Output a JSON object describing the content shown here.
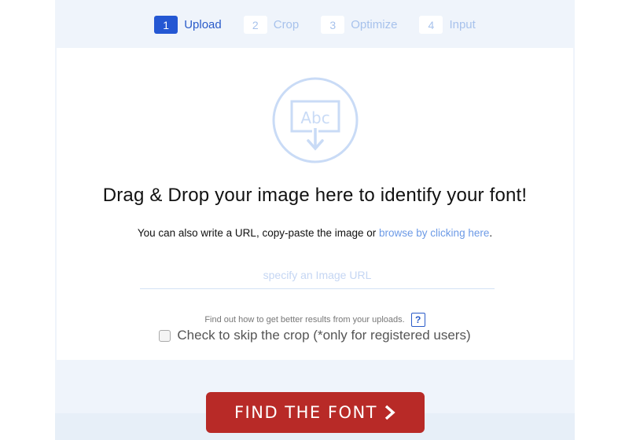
{
  "steps": [
    {
      "number": "1",
      "label": "Upload",
      "active": true
    },
    {
      "number": "2",
      "label": "Crop",
      "active": false
    },
    {
      "number": "3",
      "label": "Optimize",
      "active": false
    },
    {
      "number": "4",
      "label": "Input",
      "active": false
    }
  ],
  "upload": {
    "icon": "abc-download-icon",
    "icon_text": "Abc",
    "headline": "Drag & Drop your image here to identify your font!",
    "subline_prefix": "You can also write a URL, copy-paste the image or ",
    "browse_link": "browse by clicking here",
    "subline_suffix": ".",
    "url_placeholder": "specify an Image URL",
    "url_value": "",
    "tips_text": "Find out how to get better results from your uploads.",
    "help_label": "?",
    "skip_crop_label": "Check to skip the crop (*only for registered users)",
    "skip_crop_checked": false
  },
  "action": {
    "find_label": "FIND THE FONT",
    "find_icon": "chevron-right-icon"
  },
  "colors": {
    "accent": "#2457d3",
    "link": "#6c9ae6",
    "button": "#b82a27",
    "icon": "#c9dbf6"
  }
}
